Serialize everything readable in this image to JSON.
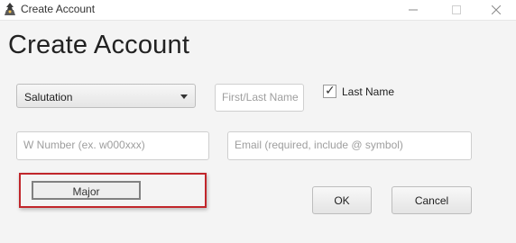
{
  "window": {
    "title": "Create Account",
    "icon": "app-icon",
    "controls": [
      "minimize-icon",
      "maximize-icon",
      "close-icon"
    ]
  },
  "form": {
    "heading": "Create Account",
    "salutation": {
      "selected": "Salutation"
    },
    "name_field": {
      "placeholder": "First/Last Name"
    },
    "last_name_checkbox": {
      "label": "Last Name",
      "checked": true
    },
    "w_number_field": {
      "placeholder": "W Number (ex. w000xxx)"
    },
    "email_field": {
      "placeholder": "Email (required, include @ symbol)"
    },
    "major_button": {
      "label": "Major"
    },
    "ok_button": {
      "label": "OK"
    },
    "cancel_button": {
      "label": "Cancel"
    }
  },
  "colors": {
    "highlight_border": "#c1262b",
    "background": "#f4f4f4"
  }
}
